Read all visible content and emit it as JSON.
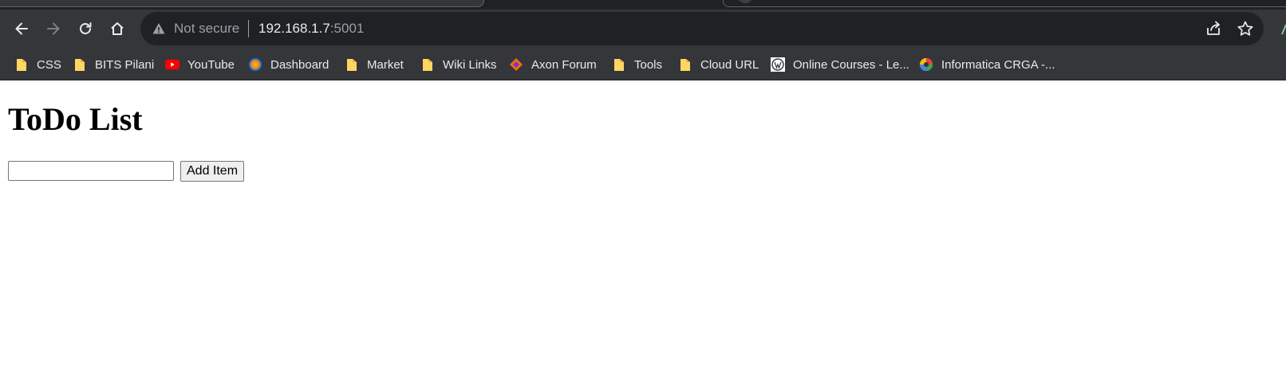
{
  "browser": {
    "address_bar": {
      "security_label": "Not secure",
      "host": "192.168.1.7",
      "port": ":5001"
    },
    "bookmarks": [
      {
        "label": "CSS",
        "icon": "folder-icon"
      },
      {
        "label": "BITS Pilani",
        "icon": "folder-icon"
      },
      {
        "label": "YouTube",
        "icon": "youtube-icon"
      },
      {
        "label": "Dashboard",
        "icon": "dashboard-icon"
      },
      {
        "label": "Market",
        "icon": "folder-icon"
      },
      {
        "label": "Wiki Links",
        "icon": "folder-icon"
      },
      {
        "label": "Axon Forum",
        "icon": "axon-icon"
      },
      {
        "label": "Tools",
        "icon": "folder-icon"
      },
      {
        "label": "Cloud URL",
        "icon": "folder-icon"
      },
      {
        "label": "Online Courses - Le...",
        "icon": "wordpress-icon"
      },
      {
        "label": "Informatica CRGA -...",
        "icon": "informatica-icon"
      }
    ],
    "colors": {
      "chrome": "#35363a",
      "omnibox": "#202124",
      "folder": "#fdd663",
      "youtube": "#ff0000"
    }
  },
  "page": {
    "title": "ToDo List",
    "input": {
      "value": "",
      "placeholder": ""
    },
    "add_button_label": "Add Item"
  }
}
